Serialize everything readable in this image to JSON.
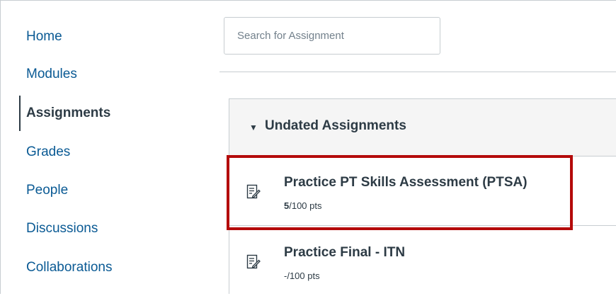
{
  "nav": {
    "items": [
      {
        "label": "Home"
      },
      {
        "label": "Modules"
      },
      {
        "label": "Assignments",
        "active": true
      },
      {
        "label": "Grades"
      },
      {
        "label": "People"
      },
      {
        "label": "Discussions"
      },
      {
        "label": "Collaborations"
      }
    ]
  },
  "search": {
    "placeholder": "Search for Assignment",
    "value": ""
  },
  "group": {
    "title": "Undated Assignments",
    "caret_icon": "caret-down-icon",
    "assignments": [
      {
        "title": "Practice PT Skills Assessment (PTSA)",
        "score": "5",
        "total": "/100 pts",
        "icon": "assignment-edit-icon"
      },
      {
        "title": "Practice Final - ITN",
        "score": "-",
        "total": "/100 pts",
        "icon": "assignment-edit-icon"
      }
    ]
  },
  "colors": {
    "link": "#0a5a94",
    "text": "#2d3b45",
    "border": "#c7cdd1",
    "header_bg": "#f5f5f5",
    "highlight": "#b40a0a"
  }
}
